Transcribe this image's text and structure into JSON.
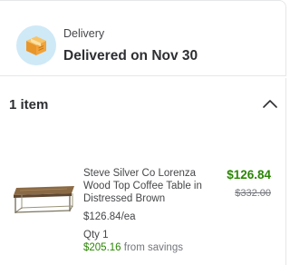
{
  "delivery": {
    "label": "Delivery",
    "status": "Delivered on Nov 30",
    "icon": "package-box-icon"
  },
  "items_section": {
    "count_label": "1 item",
    "toggle_icon": "chevron-up-icon"
  },
  "item": {
    "name": "Steve Silver Co Lorenza Wood Top Coffee Table in Distressed Brown",
    "price": "$126.84",
    "original_price": "$332.00",
    "unit_price": "$126.84/ea",
    "quantity": "Qty 1",
    "savings_amount": "$205.16",
    "savings_text": "from savings"
  },
  "colors": {
    "accent_green": "#2a8703",
    "badge_blue": "#cfe9f7",
    "box_orange": "#f2a33a"
  }
}
